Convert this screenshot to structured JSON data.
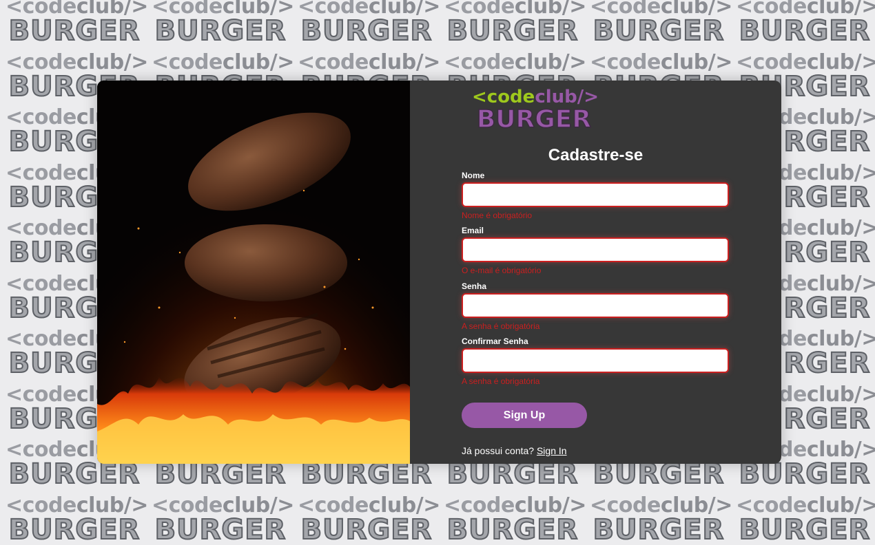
{
  "background": {
    "line1_a": "<code",
    "line1_b": "club/>",
    "line2": "BURGER"
  },
  "logo": {
    "line1_a": "<code",
    "line1_b": "club/>",
    "line2": "BURGER"
  },
  "form": {
    "title": "Cadastre-se",
    "fields": [
      {
        "label": "Nome",
        "value": "",
        "error": "Nome é obrigatório"
      },
      {
        "label": "Email",
        "value": "",
        "error": "O e-mail é obrigatório"
      },
      {
        "label": "Senha",
        "value": "",
        "error": "A senha é obrigatória"
      },
      {
        "label": "Confirmar Senha",
        "value": "",
        "error": "A senha é obrigatória"
      }
    ],
    "submit_label": "Sign Up",
    "signin_prompt": "Já possui conta?",
    "signin_link": "Sign In"
  },
  "colors": {
    "accent": "#9758a6",
    "error": "#cc1f1f",
    "logo_green": "#9ec81d",
    "panel": "#373737"
  },
  "image": {
    "subject": "burger-patties-over-flames"
  }
}
